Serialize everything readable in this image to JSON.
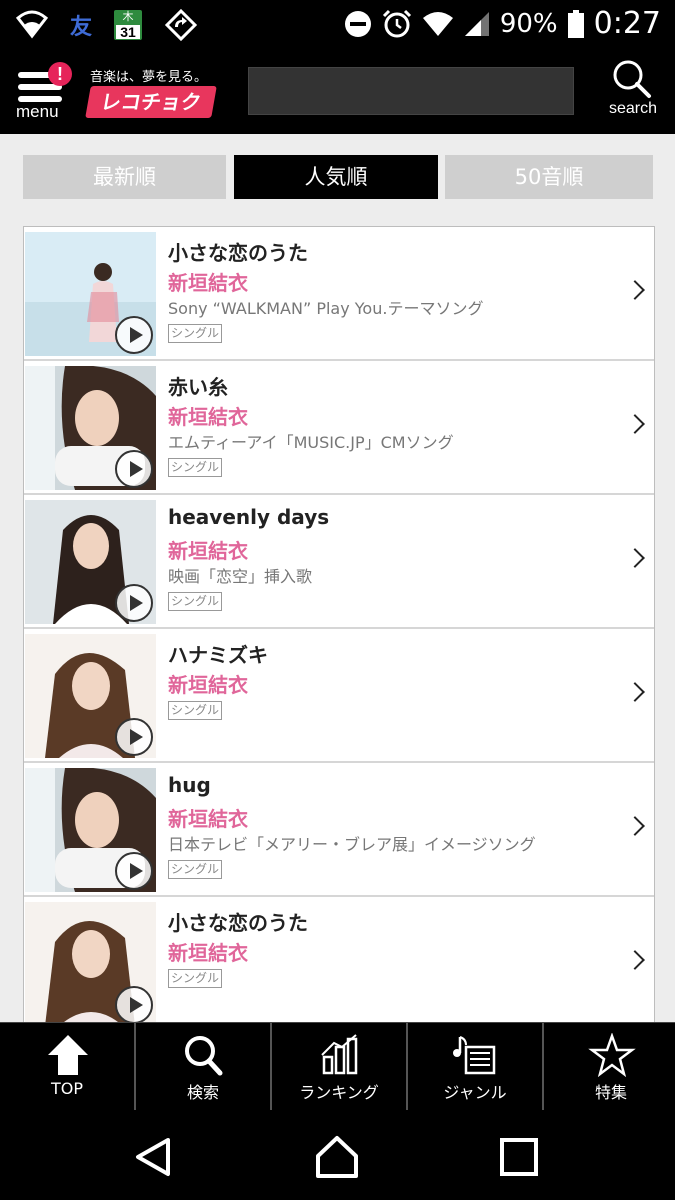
{
  "status_bar": {
    "time": "0:27",
    "battery": "90%",
    "calendar_day": "31",
    "calendar_weekday": "木",
    "tomo_label": "友",
    "icons": [
      "wifi-shield-icon",
      "tomo-icon",
      "calendar-icon",
      "sync-icon",
      "dnd-icon",
      "alarm-icon",
      "wifi-icon",
      "signal-icon",
      "battery-icon"
    ]
  },
  "header": {
    "menu_label": "menu",
    "menu_badge": "!",
    "tagline": "音楽は、夢を見る。",
    "logo_text": "レコチョク",
    "search_label": "search"
  },
  "sort_tabs": [
    {
      "label": "最新順",
      "active": false
    },
    {
      "label": "人気順",
      "active": true
    },
    {
      "label": "50音順",
      "active": false
    }
  ],
  "songs": [
    {
      "title": "小さな恋のうた",
      "artist": "新垣結衣",
      "description": "Sony “WALKMAN” Play You.テーマソング",
      "badge": "シングル"
    },
    {
      "title": "赤い糸",
      "artist": "新垣結衣",
      "description": "エムティーアイ「MUSIC.JP」CMソング",
      "badge": "シングル"
    },
    {
      "title": "heavenly days",
      "artist": "新垣結衣",
      "description": "映画「恋空」挿入歌",
      "badge": "シングル"
    },
    {
      "title": "ハナミズキ",
      "artist": "新垣結衣",
      "description": "",
      "badge": "シングル"
    },
    {
      "title": "hug",
      "artist": "新垣結衣",
      "description": "日本テレビ「メアリー・ブレア展」イメージソング",
      "badge": "シングル"
    },
    {
      "title": "小さな恋のうた",
      "artist": "新垣結衣",
      "description": "",
      "badge": "シングル"
    }
  ],
  "tab_bar": [
    {
      "label": "TOP",
      "icon": "home-icon"
    },
    {
      "label": "検索",
      "icon": "search-icon"
    },
    {
      "label": "ランキング",
      "icon": "ranking-icon"
    },
    {
      "label": "ジャンル",
      "icon": "genre-icon"
    },
    {
      "label": "特集",
      "icon": "star-icon"
    }
  ],
  "colors": {
    "accent_pink": "#e0669a",
    "logo_red": "#e8365d",
    "header_bg": "#000000"
  }
}
